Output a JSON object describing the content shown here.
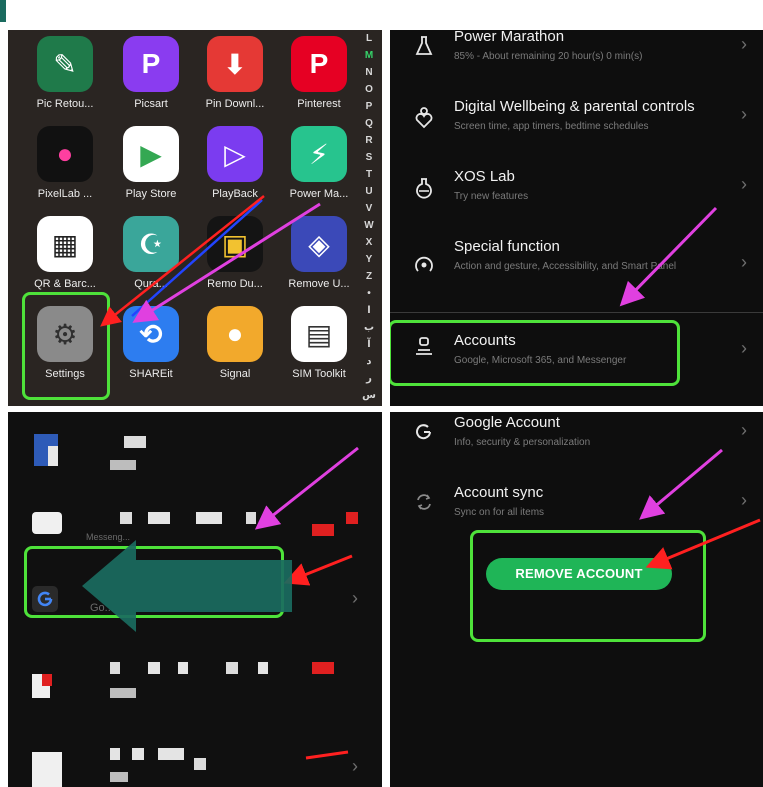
{
  "colors": {
    "highlight": "#4ee23a",
    "arrow_magenta": "#e040e0",
    "arrow_red": "#ff2020",
    "arrow_blue": "#2244ff",
    "arrow_teal": "#1a6b5f",
    "button_green": "#1fb557"
  },
  "app_drawer": {
    "apps": [
      {
        "label": "Pic Retou...",
        "icon": "pic-retouch-icon"
      },
      {
        "label": "Picsart",
        "icon": "picsart-icon"
      },
      {
        "label": "Pin Downl...",
        "icon": "pin-download-icon"
      },
      {
        "label": "Pinterest",
        "icon": "pinterest-icon"
      },
      {
        "label": "PixelLab ...",
        "icon": "pixellab-icon"
      },
      {
        "label": "Play Store",
        "icon": "play-store-icon"
      },
      {
        "label": "PlayBack",
        "icon": "playback-icon"
      },
      {
        "label": "Power Ma...",
        "icon": "power-marathon-icon"
      },
      {
        "label": "QR & Barc...",
        "icon": "qr-code-icon"
      },
      {
        "label": "Qura...",
        "icon": "quran-icon"
      },
      {
        "label": "Remo Du...",
        "icon": "remo-duplicate-icon"
      },
      {
        "label": "Remove U...",
        "icon": "eraser-icon"
      },
      {
        "label": "Settings",
        "icon": "settings-gear-icon"
      },
      {
        "label": "SHAREit",
        "icon": "shareit-icon"
      },
      {
        "label": "Signal",
        "icon": "signal-icon"
      },
      {
        "label": "SIM Toolkit",
        "icon": "sim-card-icon"
      }
    ],
    "alphabet": [
      "L",
      "M",
      "N",
      "O",
      "P",
      "Q",
      "R",
      "S",
      "T",
      "U",
      "V",
      "W",
      "X",
      "Y",
      "Z",
      "•",
      "ا",
      "ب",
      "آ",
      "د",
      "ر",
      "س"
    ],
    "active_letter": "M"
  },
  "settings_menu": {
    "items": [
      {
        "title": "Power Marathon",
        "subtitle": "85% - About remaining 20 hour(s) 0 min(s)",
        "icon": "flask-icon"
      },
      {
        "title": "Digital Wellbeing & parental controls",
        "subtitle": "Screen time, app timers, bedtime schedules",
        "icon": "wellbeing-heart-icon"
      },
      {
        "title": "XOS Lab",
        "subtitle": "Try new features",
        "icon": "lab-flask-icon"
      },
      {
        "title": "Special function",
        "subtitle": "Action and gesture, Accessibility, and Smart Panel",
        "icon": "special-function-icon"
      },
      {
        "title": "Accounts",
        "subtitle": "Google, Microsoft 365, and Messenger",
        "icon": "account-person-icon"
      }
    ]
  },
  "accounts_list": {
    "partial_text": [
      "Messeng...",
      "Go..."
    ]
  },
  "google_account": {
    "items": [
      {
        "title": "Google Account",
        "subtitle": "Info, security & personalization",
        "icon": "google-g-icon"
      },
      {
        "title": "Account sync",
        "subtitle": "Sync on for all items",
        "icon": "sync-icon"
      }
    ],
    "remove_button": "REMOVE ACCOUNT"
  }
}
